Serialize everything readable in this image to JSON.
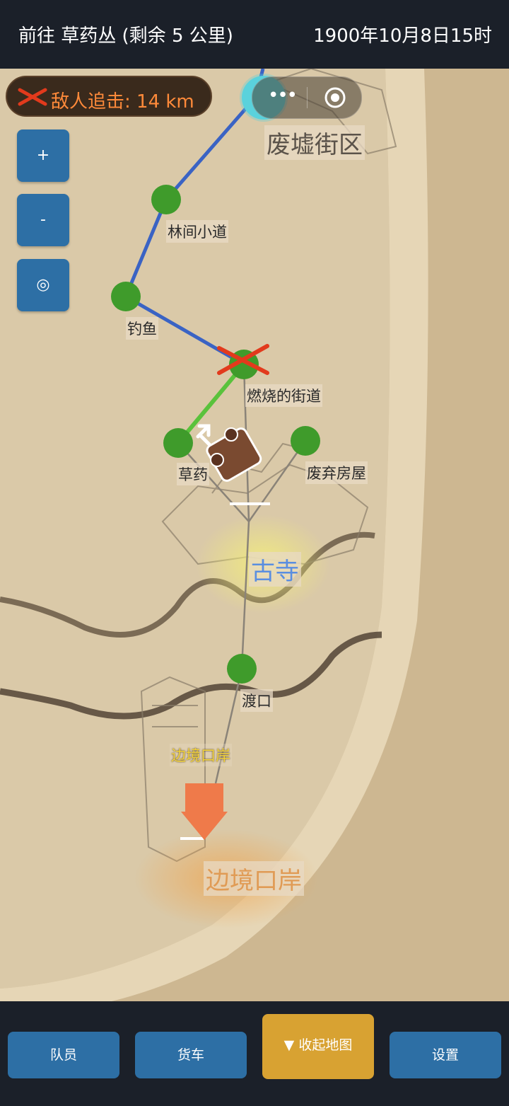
{
  "header": {
    "destination": "前往 草药丛 (剩余 5 公里)",
    "datetime": "1900年10月8日15时"
  },
  "enemy": {
    "text": "敌人追击: 14 km",
    "icon": "crossed-swords-icon"
  },
  "capsule": {
    "more_icon": "more-dots-icon",
    "close_icon": "target-icon",
    "more_glyph": "•••"
  },
  "zoom": {
    "in_label": "+",
    "out_label": "-",
    "locate_label": "◎"
  },
  "map": {
    "regions": {
      "ruins": "废墟街区",
      "temple": "古寺",
      "border": "边境口岸"
    },
    "nodes": {
      "forest_path": "林间小道",
      "fishing": "钓鱼",
      "burning_street": "燃烧的街道",
      "herb_bush": "草药丛",
      "herb_bush_visible": "草药",
      "abandoned_house": "废弃房屋",
      "ferry": "渡口",
      "border_post": "边境口岸"
    },
    "colors": {
      "visited_route": "#3a63c4",
      "current_route": "#5ac23c",
      "future_route": "#8a8378",
      "node": "#3f9b2b",
      "danger": "#e23a1c",
      "destination_arrow": "#ef7a4a"
    }
  },
  "footer": {
    "team": "队员",
    "wagon": "货车",
    "collapse_map": "▼ 收起地图",
    "settings": "设置"
  }
}
